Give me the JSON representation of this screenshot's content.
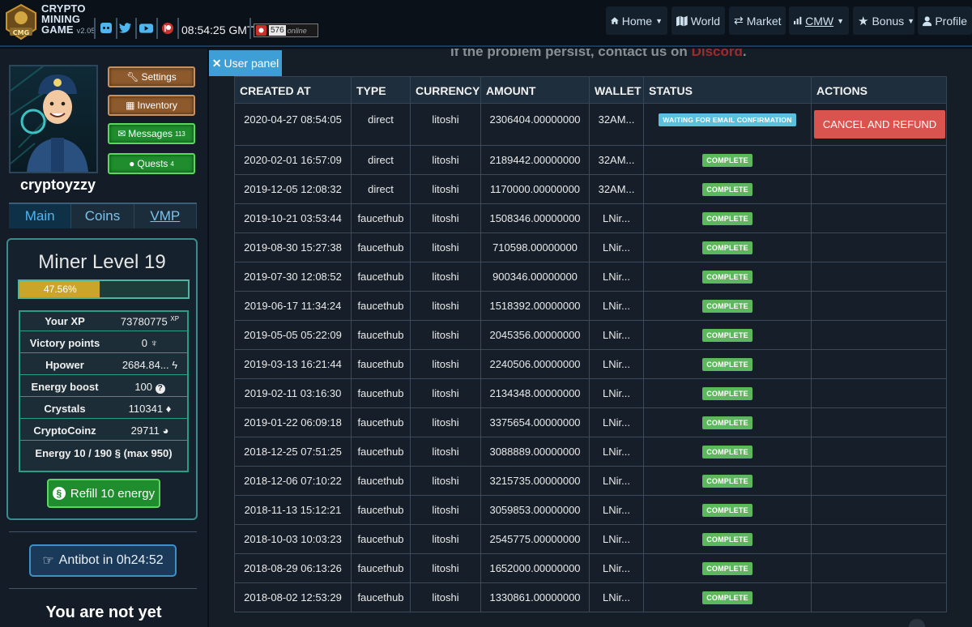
{
  "header": {
    "logo_lines": [
      "CRYPTO",
      "MINING",
      "GAME"
    ],
    "version": "v2.05",
    "clock": "08:54:25 GMT",
    "online_count": "576",
    "online_label": "online",
    "social_icons": [
      "discord-icon",
      "twitter-icon",
      "youtube-icon",
      "patreon-icon"
    ],
    "nav": [
      {
        "label": "Home",
        "icon": "home-icon",
        "dropdown": true
      },
      {
        "label": "World",
        "icon": "map-icon",
        "dropdown": false
      },
      {
        "label": "Market",
        "icon": "exchange-icon",
        "dropdown": false
      },
      {
        "label": "CMW",
        "icon": "chart-icon",
        "dropdown": true
      },
      {
        "label": "Bonus",
        "icon": "star-icon",
        "dropdown": true
      },
      {
        "label": "Profile",
        "icon": "user-icon",
        "dropdown": false
      }
    ]
  },
  "sidebar": {
    "username": "cryptoyzzy",
    "buttons": {
      "settings": "Settings",
      "inventory": "Inventory",
      "messages": "Messages",
      "messages_count": "113",
      "quests": "Quests",
      "quests_count": "4"
    },
    "tabs": [
      "Main",
      "Coins",
      "VMP"
    ],
    "active_tab": "Main",
    "level_title": "Miner Level 19",
    "xp_percent_text": "47.56%",
    "xp_fraction": 0.4756,
    "stats": [
      {
        "label": "Your XP",
        "value": "73780775",
        "suffix": "XP"
      },
      {
        "label": "Victory points",
        "value": "0",
        "icon": "shield-icon"
      },
      {
        "label": "Hpower",
        "value": "2684.84...",
        "icon": "bolt-icon"
      },
      {
        "label": "Energy boost",
        "value": "100",
        "icon": "question-icon"
      },
      {
        "label": "Crystals",
        "value": "110341",
        "icon": "crystal-icon"
      },
      {
        "label": "CryptoCoinz",
        "value": "29711",
        "icon": "coin-icon"
      }
    ],
    "energy_line": "Energy 10 / 190 (max 950)",
    "energy_pre": "Energy 10 / 190",
    "energy_post": "(max 950)",
    "refill_label": "Refill 10 energy",
    "antibot_label": "Antibot in 0h24:52",
    "not_yet_label": "You are not yet"
  },
  "main": {
    "hint_text": "If the problem persist, contact us on",
    "hint_link": "Discord",
    "hint_end": ".",
    "panel_tab": "User panel",
    "columns": [
      "CREATED AT",
      "TYPE",
      "CURRENCY",
      "AMOUNT",
      "WALLET",
      "STATUS",
      "ACTIONS"
    ],
    "rows": [
      {
        "created": "2020-04-27 08:54:05",
        "type": "direct",
        "currency": "litoshi",
        "amount": "2306404.00000000",
        "wallet": "32AM...",
        "status": "WAITING FOR EMAIL CONFIRMATION",
        "action": "CANCEL AND REFUND"
      },
      {
        "created": "2020-02-01 16:57:09",
        "type": "direct",
        "currency": "litoshi",
        "amount": "2189442.00000000",
        "wallet": "32AM...",
        "status": "COMPLETE",
        "action": ""
      },
      {
        "created": "2019-12-05 12:08:32",
        "type": "direct",
        "currency": "litoshi",
        "amount": "1170000.00000000",
        "wallet": "32AM...",
        "status": "COMPLETE",
        "action": ""
      },
      {
        "created": "2019-10-21 03:53:44",
        "type": "faucethub",
        "currency": "litoshi",
        "amount": "1508346.00000000",
        "wallet": "LNir...",
        "status": "COMPLETE",
        "action": ""
      },
      {
        "created": "2019-08-30 15:27:38",
        "type": "faucethub",
        "currency": "litoshi",
        "amount": "710598.00000000",
        "wallet": "LNir...",
        "status": "COMPLETE",
        "action": ""
      },
      {
        "created": "2019-07-30 12:08:52",
        "type": "faucethub",
        "currency": "litoshi",
        "amount": "900346.00000000",
        "wallet": "LNir...",
        "status": "COMPLETE",
        "action": ""
      },
      {
        "created": "2019-06-17 11:34:24",
        "type": "faucethub",
        "currency": "litoshi",
        "amount": "1518392.00000000",
        "wallet": "LNir...",
        "status": "COMPLETE",
        "action": ""
      },
      {
        "created": "2019-05-05 05:22:09",
        "type": "faucethub",
        "currency": "litoshi",
        "amount": "2045356.00000000",
        "wallet": "LNir...",
        "status": "COMPLETE",
        "action": ""
      },
      {
        "created": "2019-03-13 16:21:44",
        "type": "faucethub",
        "currency": "litoshi",
        "amount": "2240506.00000000",
        "wallet": "LNir...",
        "status": "COMPLETE",
        "action": ""
      },
      {
        "created": "2019-02-11 03:16:30",
        "type": "faucethub",
        "currency": "litoshi",
        "amount": "2134348.00000000",
        "wallet": "LNir...",
        "status": "COMPLETE",
        "action": ""
      },
      {
        "created": "2019-01-22 06:09:18",
        "type": "faucethub",
        "currency": "litoshi",
        "amount": "3375654.00000000",
        "wallet": "LNir...",
        "status": "COMPLETE",
        "action": ""
      },
      {
        "created": "2018-12-25 07:51:25",
        "type": "faucethub",
        "currency": "litoshi",
        "amount": "3088889.00000000",
        "wallet": "LNir...",
        "status": "COMPLETE",
        "action": ""
      },
      {
        "created": "2018-12-06 07:10:22",
        "type": "faucethub",
        "currency": "litoshi",
        "amount": "3215735.00000000",
        "wallet": "LNir...",
        "status": "COMPLETE",
        "action": ""
      },
      {
        "created": "2018-11-13 15:12:21",
        "type": "faucethub",
        "currency": "litoshi",
        "amount": "3059853.00000000",
        "wallet": "LNir...",
        "status": "COMPLETE",
        "action": ""
      },
      {
        "created": "2018-10-03 10:03:23",
        "type": "faucethub",
        "currency": "litoshi",
        "amount": "2545775.00000000",
        "wallet": "LNir...",
        "status": "COMPLETE",
        "action": ""
      },
      {
        "created": "2018-08-29 06:13:26",
        "type": "faucethub",
        "currency": "litoshi",
        "amount": "1652000.00000000",
        "wallet": "LNir...",
        "status": "COMPLETE",
        "action": ""
      },
      {
        "created": "2018-08-02 12:53:29",
        "type": "faucethub",
        "currency": "litoshi",
        "amount": "1330861.00000000",
        "wallet": "LNir...",
        "status": "COMPLETE",
        "action": ""
      }
    ]
  },
  "colors": {
    "accent_blue": "#3d9fd6",
    "complete_green": "#5cb85c",
    "waiting_cyan": "#5bc0de",
    "cancel_red": "#d9534f",
    "xp_gold": "#c9a52a"
  }
}
